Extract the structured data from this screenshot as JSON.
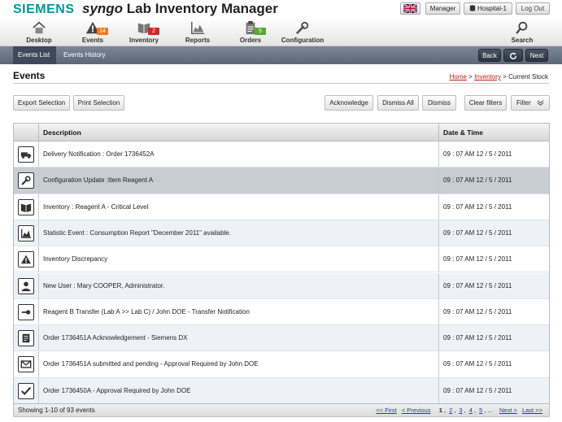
{
  "header": {
    "brand": "SIEMENS",
    "app_prefix": "syngo",
    "app_title": " Lab Inventory Manager",
    "language_flag": "uk-flag-icon",
    "role_button": "Manager",
    "site_button": "Hospital-1",
    "logout_button": "Log Out"
  },
  "nav": {
    "items": [
      {
        "label": "Desktop",
        "icon": "house-icon"
      },
      {
        "label": "Events",
        "icon": "warning-icon",
        "badge": "14",
        "badge_color": "#f07a1a"
      },
      {
        "label": "Inventory",
        "icon": "book-icon",
        "badge": "2",
        "badge_color": "#d0262a"
      },
      {
        "label": "Reports",
        "icon": "chart-icon"
      },
      {
        "label": "Orders",
        "icon": "clipboard-icon",
        "badge": "5",
        "badge_color": "#5aa832"
      },
      {
        "label": "Configuration",
        "icon": "wrench-icon"
      },
      {
        "label": "Search",
        "icon": "search-icon"
      }
    ]
  },
  "subnav": {
    "tabs": [
      "Events List",
      "Events History"
    ],
    "back": "Back",
    "next": "Next"
  },
  "page": {
    "title": "Events",
    "breadcrumb": {
      "home": "Home",
      "sep1": " > ",
      "inventory": "Inventory",
      "sep2": " > ",
      "current": "Current Stock"
    }
  },
  "toolbar": {
    "export": "Export Selection",
    "print": "Print Selection",
    "acknowledge": "Acknowledge",
    "dismiss_all": "Dismiss All",
    "dismiss": "Dismiss",
    "clear_filters": "Clear filters",
    "filter": "Filter"
  },
  "table": {
    "columns": [
      "Description",
      "Date & Time"
    ],
    "rows": [
      {
        "icon": "truck-icon",
        "description": "Delivery Notification : Order 1736452A",
        "datetime": "09 : 07 AM 12 / 5 / 2011"
      },
      {
        "icon": "wrench-icon",
        "description": "Configuration Update :Item Reagent A",
        "datetime": "09 : 07 AM 12 / 5 / 2011",
        "selected": true
      },
      {
        "icon": "book-icon",
        "description": "Inventory : Reagent A - Critical Level",
        "datetime": "09 : 07 AM 12 / 5 / 2011"
      },
      {
        "icon": "chart-icon",
        "description": "Statistic Event : Consumption Report \"December 2011\" available.",
        "datetime": "09 : 07 AM 12 / 5 / 2011"
      },
      {
        "icon": "warning-icon",
        "description": "Inventory Discrepancy",
        "datetime": "09 : 07 AM 12 / 5 / 2011"
      },
      {
        "icon": "user-icon",
        "description": "New User : Mary COOPER, Administrator.",
        "datetime": "09 : 07 AM 12 / 5 / 2011"
      },
      {
        "icon": "transfer-icon",
        "description": "Reagent B Transfer (Lab A >> Lab C) / John DOE - Transfer Notification",
        "datetime": "09 : 07 AM 12 / 5 / 2011"
      },
      {
        "icon": "document-icon",
        "description": "Order 1736451A Acknowledgement - Siemens DX",
        "datetime": "09 : 07 AM 12 / 5 / 2011"
      },
      {
        "icon": "envelope-icon",
        "description": "Order 1736451A submitted and pending - Approval Required by John DOE",
        "datetime": "09 : 07 AM 12 / 5 / 2011"
      },
      {
        "icon": "checkmark-icon",
        "description": "Order  1736450A - Approval Required by John DOE",
        "datetime": "09 : 07 AM 12 / 5 / 2011"
      }
    ]
  },
  "footer": {
    "showing": "Showing 1-10 of 93 events",
    "first": "<< First",
    "previous": "< Previous",
    "pages": [
      "1",
      "2",
      "3",
      "4",
      "5",
      "..."
    ],
    "next": "Next >",
    "last": "Last >>"
  }
}
